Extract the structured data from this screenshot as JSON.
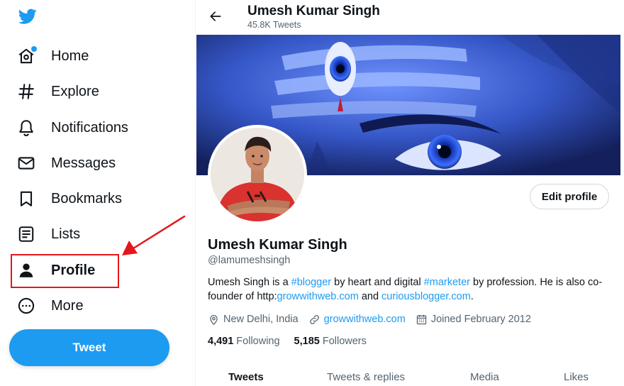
{
  "sidebar": {
    "items": [
      {
        "label": "Home",
        "icon": "home-icon"
      },
      {
        "label": "Explore",
        "icon": "hashtag-icon"
      },
      {
        "label": "Notifications",
        "icon": "bell-icon"
      },
      {
        "label": "Messages",
        "icon": "envelope-icon"
      },
      {
        "label": "Bookmarks",
        "icon": "bookmark-icon"
      },
      {
        "label": "Lists",
        "icon": "list-icon"
      },
      {
        "label": "Profile",
        "icon": "person-icon"
      },
      {
        "label": "More",
        "icon": "more-circle-icon"
      }
    ],
    "tweet_button": "Tweet"
  },
  "header": {
    "name": "Umesh Kumar Singh",
    "tweet_count": "45.8K Tweets"
  },
  "profile": {
    "name": "Umesh Kumar Singh",
    "handle": "@lamumeshsingh",
    "edit_button": "Edit profile",
    "bio": {
      "t1": "Umesh Singh is a ",
      "l1": "#blogger",
      "t2": " by heart and digital ",
      "l2": "#marketer",
      "t3": " by profession. He is also co-founder of http:",
      "l3": "growwithweb.com",
      "t4": " and ",
      "l4": "curiousblogger.com",
      "t5": "."
    },
    "location": "New Delhi, India",
    "website": "growwithweb.com",
    "joined": "Joined February 2012",
    "following_count": "4,491",
    "following_label": "Following",
    "followers_count": "5,185",
    "followers_label": "Followers"
  },
  "tabs": [
    "Tweets",
    "Tweets & replies",
    "Media",
    "Likes"
  ],
  "colors": {
    "accent": "#1d9bf0",
    "highlight": "#e3171c",
    "muted": "#536471"
  }
}
